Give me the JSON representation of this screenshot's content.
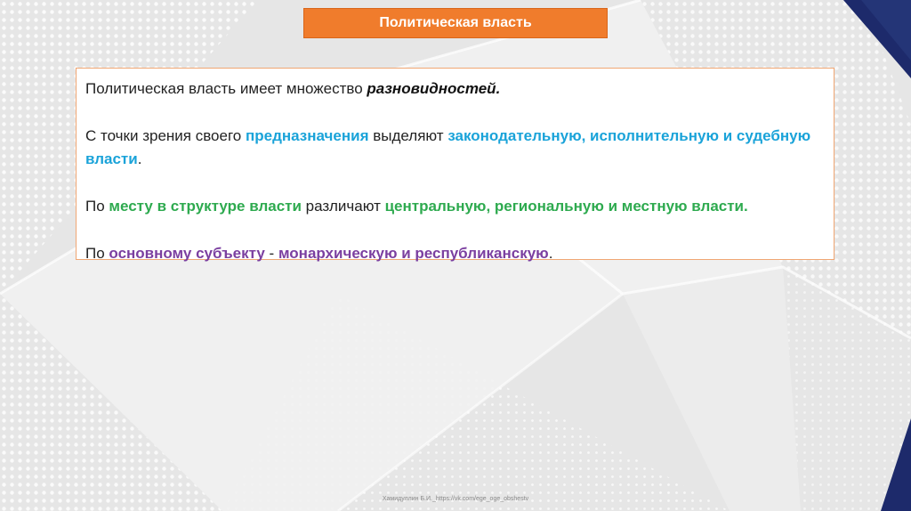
{
  "slide": {
    "title": "Политическая власть",
    "paragraphs": {
      "p1": {
        "t1": "Политическая власть имеет множество ",
        "t2": "разновидностей."
      },
      "p2": {
        "t1": "С точки зрения своего ",
        "t2": "предназначения",
        "t3": " выделяют ",
        "t4": "законодательную, исполнительную и судебную власти",
        "t5": "."
      },
      "p3": {
        "t1": "По ",
        "t2": "месту в структуре власти",
        "t3": " различают ",
        "t4": "центральную, региональную и местную власти."
      },
      "p4": {
        "t1": "По ",
        "t2": "основному субъекту",
        "t3": " - ",
        "t4": "монархическую и республиканскую",
        "t5": "."
      }
    },
    "footer": "Хамидуллин Б.И._https://vk.com/ege_oge_obshestv"
  },
  "colors": {
    "title_bg": "#f07c2c",
    "box_border": "#f0a673",
    "blue": "#1aa3d9",
    "green": "#2eaa4f",
    "purple": "#7b3fa0",
    "navy": "#1d2a6b"
  }
}
